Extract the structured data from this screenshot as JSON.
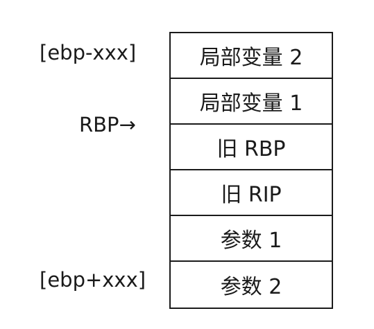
{
  "labels": {
    "ebp_minus": "[ebp-xxx]",
    "rbp_pointer": "RBP→",
    "ebp_plus": "[ebp+xxx]"
  },
  "stack": {
    "cells": [
      "局部变量 2",
      "局部变量 1",
      "旧 RBP",
      "旧 RIP",
      "参数 1",
      "参数 2"
    ]
  }
}
